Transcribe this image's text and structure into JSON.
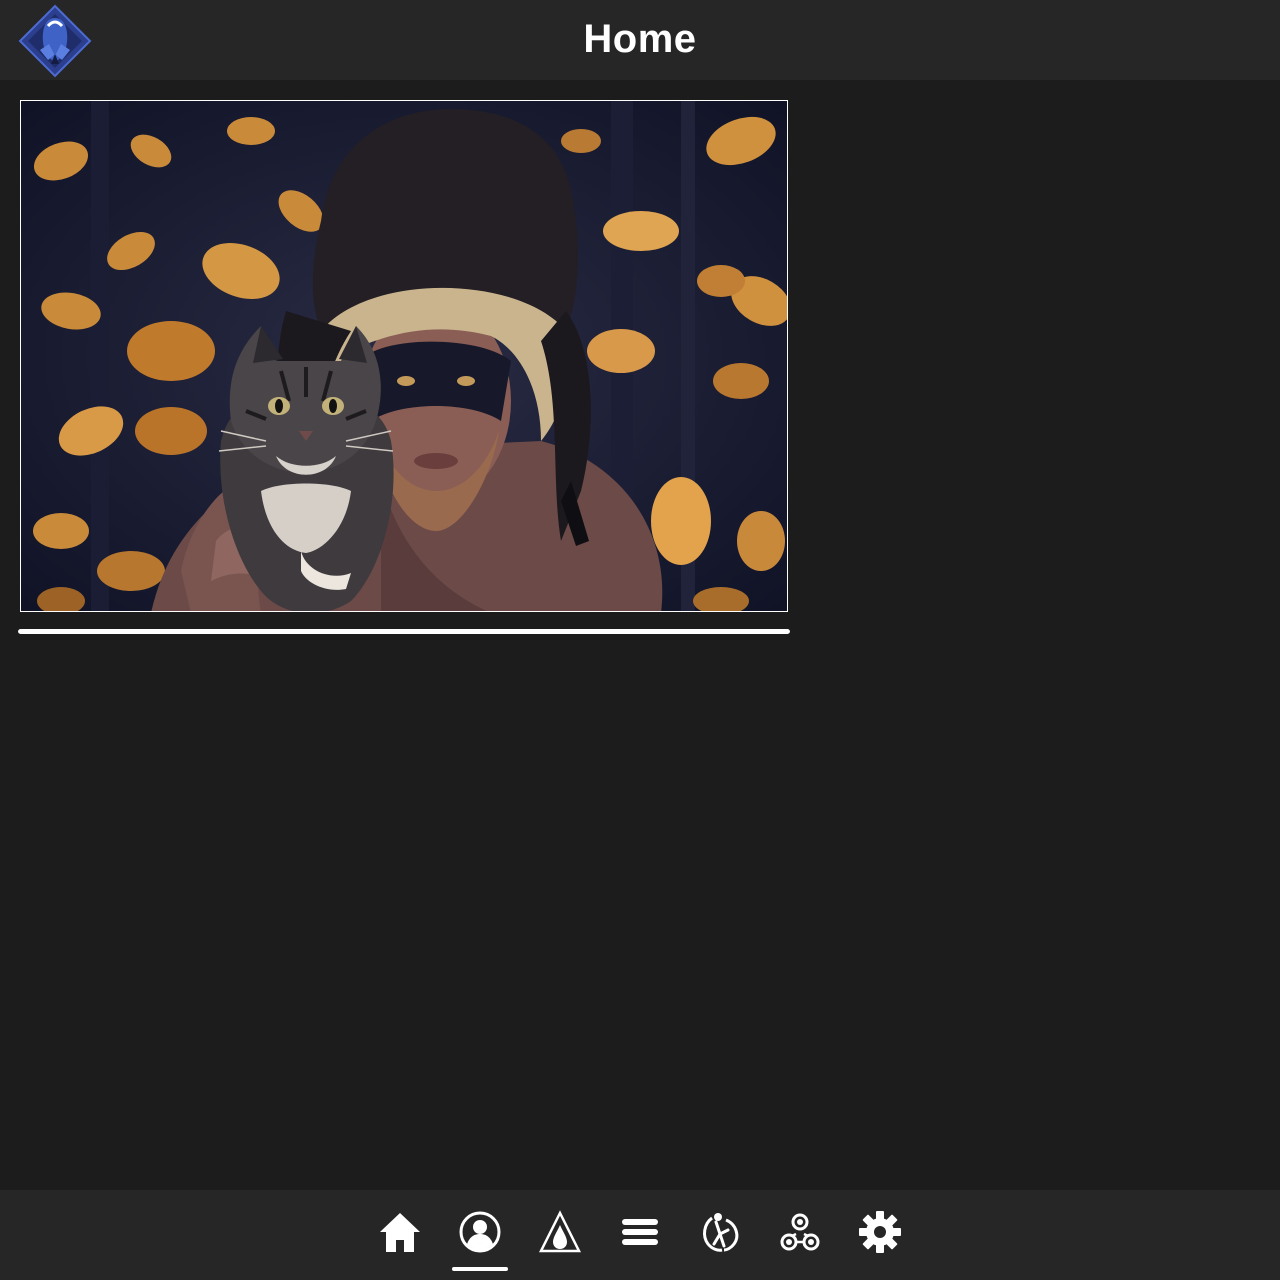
{
  "header": {
    "title": "Home",
    "logo_icon": "app-logo-icon",
    "logo_colors": [
      "#2c3f8f",
      "#3f62c7"
    ]
  },
  "post": {
    "image_icon": "photo-man-with-cat",
    "progress": 1.0
  },
  "bottom_nav": {
    "active_index": 1,
    "items": [
      {
        "icon": "home-icon"
      },
      {
        "icon": "profile-icon"
      },
      {
        "icon": "drop-triangle-icon"
      },
      {
        "icon": "menu-icon"
      },
      {
        "icon": "activity-icon"
      },
      {
        "icon": "community-icon"
      },
      {
        "icon": "settings-gear-icon"
      }
    ]
  },
  "colors": {
    "background": "#1c1c1c",
    "bar": "#262626",
    "text": "#ffffff",
    "accent": "#3f62c7"
  }
}
